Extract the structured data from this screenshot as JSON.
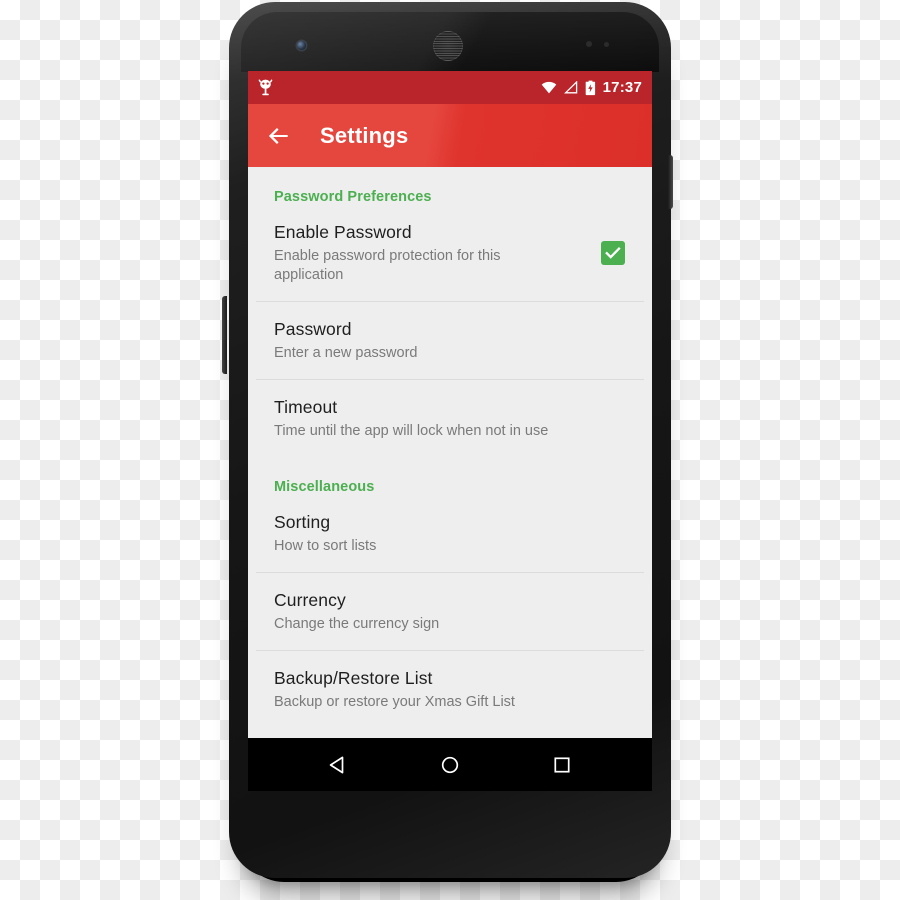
{
  "device": {
    "frame_color": "#161616",
    "camera_icon": "front-camera",
    "speaker_icon": "earpiece-speaker"
  },
  "screen": {
    "status_bar": {
      "background": "#b9252a",
      "notification_icon": "android-robot-icon",
      "icons": [
        "wifi-icon",
        "signal-icon",
        "battery-charging-icon"
      ],
      "time": "17:37"
    },
    "app_bar": {
      "background": "#e03b35",
      "back_icon": "back-arrow-icon",
      "title": "Settings"
    },
    "settings": {
      "accent_color": "#4caf50",
      "sections": [
        {
          "header": "Password Preferences",
          "items": [
            {
              "title": "Enable Password",
              "summary": "Enable password protection for this application",
              "widget": "checkbox",
              "checked": true
            },
            {
              "title": "Password",
              "summary": "Enter a new password",
              "widget": "none"
            },
            {
              "title": "Timeout",
              "summary": "Time until the app will lock when not in use",
              "widget": "none"
            }
          ]
        },
        {
          "header": "Miscellaneous",
          "items": [
            {
              "title": "Sorting",
              "summary": "How to sort lists",
              "widget": "none"
            },
            {
              "title": "Currency",
              "summary": "Change the currency sign",
              "widget": "none"
            },
            {
              "title": "Backup/Restore List",
              "summary": "Backup or restore your Xmas Gift List",
              "widget": "none"
            }
          ]
        }
      ]
    },
    "nav_bar": {
      "background": "#000000",
      "buttons": [
        "back-triangle-icon",
        "home-circle-icon",
        "recents-square-icon"
      ]
    }
  }
}
